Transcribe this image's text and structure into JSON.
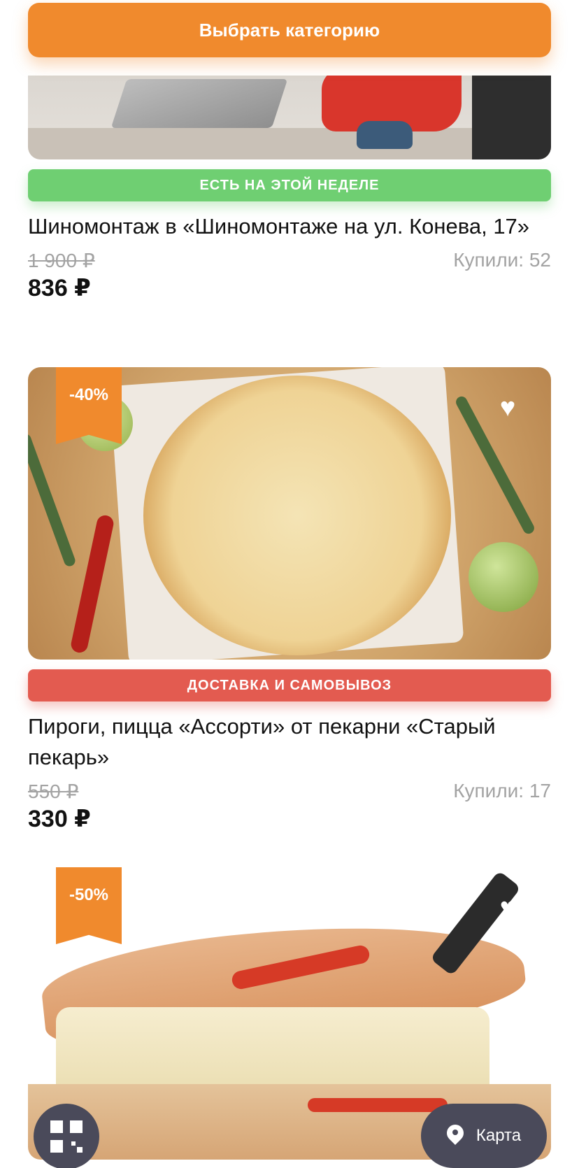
{
  "header": {
    "category_button": "Выбрать категорию"
  },
  "colors": {
    "accent": "#f08a2d",
    "green_badge": "#6fcf72",
    "red_badge": "#e35b50",
    "fab": "#4a4a5a"
  },
  "deals": [
    {
      "badge": "ЕСТЬ НА ЭТОЙ НЕДЕЛЕ",
      "title": "Шиномонтаж в «Шиномонтаже на ул. Конева, 17»",
      "old_price": "1 900 ₽",
      "new_price": "836 ₽",
      "bought": "Купили: 52"
    },
    {
      "discount": "-40%",
      "badge": "ДОСТАВКА И САМОВЫВОЗ",
      "title": "Пироги, пицца «Ассорти» от пекарни «Старый пекарь»",
      "old_price": "550 ₽",
      "new_price": "330 ₽",
      "bought": "Купили: 17"
    },
    {
      "discount": "-50%"
    }
  ],
  "fab": {
    "map_label": "Карта"
  }
}
